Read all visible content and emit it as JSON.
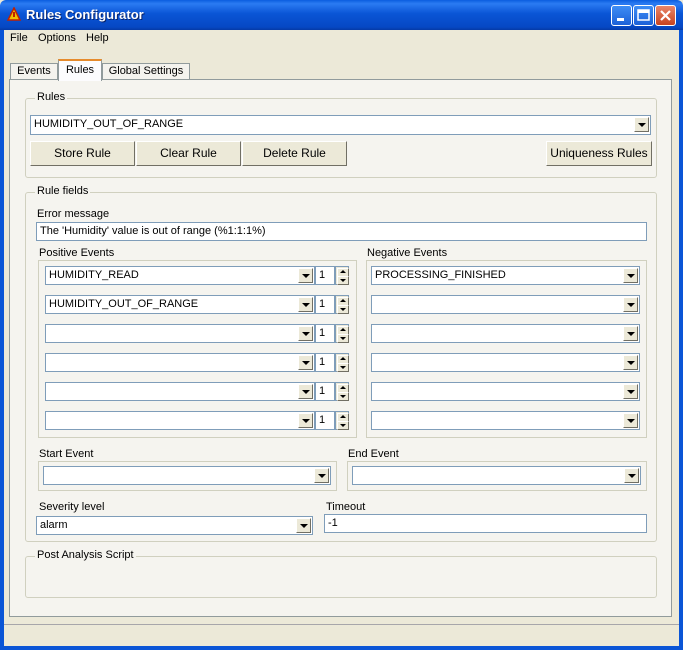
{
  "window": {
    "title": "Rules Configurator"
  },
  "menu": [
    "File",
    "Options",
    "Help"
  ],
  "tabs": [
    {
      "label": "Events",
      "active": false
    },
    {
      "label": "Rules",
      "active": true
    },
    {
      "label": "Global Settings",
      "active": false
    }
  ],
  "rules_group": {
    "label": "Rules",
    "selected_rule": "HUMIDITY_OUT_OF_RANGE",
    "buttons": {
      "store": "Store Rule",
      "clear": "Clear Rule",
      "delete": "Delete Rule",
      "uniqueness": "Uniqueness Rules"
    }
  },
  "rule_fields": {
    "label": "Rule fields",
    "error_label": "Error message",
    "error_value": "The 'Humidity' value is out of range (%1:1:1%)",
    "positive_label": "Positive Events",
    "positive_events": [
      {
        "value": "HUMIDITY_READ",
        "count": "1"
      },
      {
        "value": "HUMIDITY_OUT_OF_RANGE",
        "count": "1"
      },
      {
        "value": "",
        "count": "1"
      },
      {
        "value": "",
        "count": "1"
      },
      {
        "value": "",
        "count": "1"
      },
      {
        "value": "",
        "count": "1"
      }
    ],
    "negative_label": "Negative Events",
    "negative_events": [
      "PROCESSING_FINISHED",
      "",
      "",
      "",
      "",
      ""
    ],
    "start_label": "Start Event",
    "start_value": "",
    "end_label": "End Event",
    "end_value": "",
    "severity_label": "Severity level",
    "severity_value": "alarm",
    "timeout_label": "Timeout",
    "timeout_value": "-1"
  },
  "post_script": {
    "label": "Post Analysis Script"
  },
  "colors": {
    "titlebar": "#0a5ddf",
    "window": "#ece9d8",
    "panel": "#f5f4ef",
    "active_tab_accent": "#e68b2c"
  }
}
